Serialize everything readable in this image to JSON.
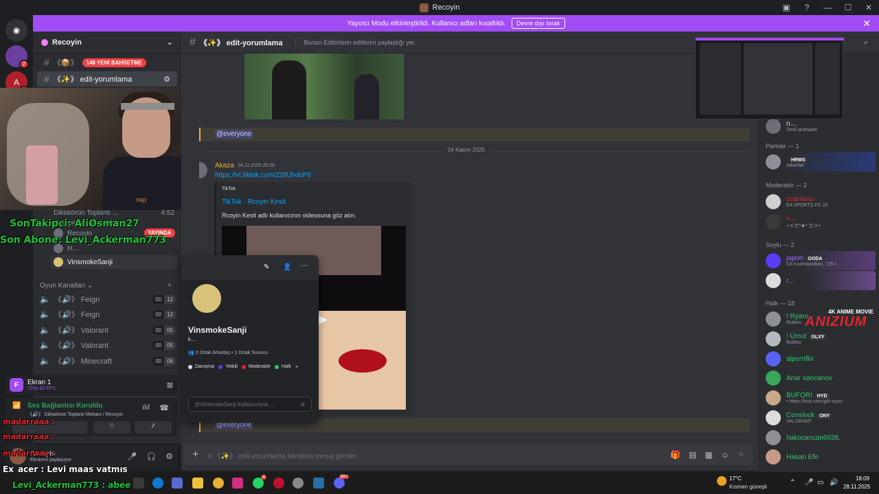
{
  "window": {
    "title": "Recoyin",
    "controls": [
      "?",
      "—",
      "☐",
      "✕"
    ]
  },
  "banner": {
    "message": "Yayıncı Modu etkinleştirildi. Kullanıcı adları kısaltıldı.",
    "button": "Devre dışı bırak",
    "accent": "#a14cf5"
  },
  "servers": {
    "badges": [
      "7",
      "2"
    ]
  },
  "sidebar": {
    "guild_name": "Recoyin",
    "channels": [
      {
        "name": "《📦》",
        "badge": "148 YENİ BAHSETME"
      },
      {
        "name": "《✨》 edit-yorumlama"
      }
    ],
    "voice_users": [
      {
        "name": "Diktatörün Toplantı ...",
        "meta": "4:52"
      },
      {
        "name": "Bir kanal duyurusu belirle"
      },
      {
        "name": "Recoyin",
        "badge": "YAYINDA"
      },
      {
        "name": "H..."
      },
      {
        "name": "VinsmokeSanji"
      }
    ],
    "games_category": "Oyun Kanalları",
    "voice_channels": [
      {
        "name": "《🔊》 Feign",
        "count_a": "00",
        "count_b": "12"
      },
      {
        "name": "《🔊》 Feign",
        "count_a": "00",
        "count_b": "12"
      },
      {
        "name": "《🔊》 Valorant",
        "count_a": "00",
        "count_b": "05"
      },
      {
        "name": "《🔊》 Valorant",
        "count_a": "00",
        "count_b": "05"
      },
      {
        "name": "《🔊》 Minecraft",
        "count_a": "00",
        "count_b": "06"
      }
    ]
  },
  "stream_overlay": {
    "last_follower": "SonTakipci: AliOsman27",
    "last_sub": "Son Abone: Levi_Ackerman773",
    "chat": [
      {
        "user": "madarraaa",
        "text": ":"
      },
      {
        "user": "madarraaa",
        "text": ":"
      },
      {
        "user": "madarraaa",
        "text": ":"
      }
    ],
    "chat_line": "Ex_acer : Levi maaş yatmış",
    "chat_line2": "Levi_Ackerman773 : abee",
    "webcam_shirt": "nap"
  },
  "screenshare": {
    "title": "Ekran 1",
    "quality": "720p 60 FPS",
    "letter": "F"
  },
  "voice_status": {
    "title": "Ses Bağlantısı Kuruldu",
    "channel": "《🔊》 Diktatörün Toplantı Mekanı / Recoyin"
  },
  "userbar": {
    "name": "Recoyin",
    "status": "Ekranını paylaşıyor"
  },
  "channel_header": {
    "name": "《✨》 edit-yorumlama",
    "topic": "Burası Editörlerin editlerini paylaştığı yer."
  },
  "messages": {
    "mention1": "@everyone",
    "date_separator": "24 Kasım 2025",
    "author": "Akaza",
    "timestamp": "24.11.2025 20:56",
    "link": "https://vt.tiktok.com/ZSfUhdoPt/",
    "embed_provider": "TikTok",
    "embed_title": "TikTok · Rcoyin Kesit",
    "embed_desc": "Rcoyin Kesit adlı kullanıcının videosuna göz atın.",
    "mention2": "@everyone"
  },
  "profile_popup": {
    "name": "VinsmokeSanji",
    "status": "k...",
    "mutual": "2 Ortak Arkadaş",
    "mutual_servers": "1 Ortak Sunucu",
    "roles": [
      {
        "name": "Danışma",
        "color": "#dbdee1"
      },
      {
        "name": "Yetkili",
        "color": "#5b3df5"
      },
      {
        "name": "Moderatör",
        "color": "#e3242b"
      },
      {
        "name": "Halk",
        "color": "#2dc770"
      }
    ],
    "message_placeholder": "@VinsmokeSanji kullanıcısına ..."
  },
  "composer": {
    "placeholder": "# 《✨》 edit-yorumlama kanalına mesaj gönder"
  },
  "members": {
    "top_sub": "Sesli aramada",
    "groups": [
      {
        "title": "Partner — 1",
        "items": [
          {
            "name": "",
            "tag": "HRMS",
            "sub": "Adamlar"
          }
        ]
      },
      {
        "title": "Moderatör — 2",
        "items": [
          {
            "name": "ccankmu",
            "sub": "EA SPORTS FC 25"
          },
          {
            "name": "v...",
            "sub": "+メ亗*★* 亗メ+"
          }
        ]
      },
      {
        "title": "Soylu — 2",
        "items": [
          {
            "name": "japon",
            "tag": "GODA",
            "sub": "D3 Kozmopolitan, 725 •"
          },
          {
            "name": "r..."
          }
        ]
      },
      {
        "title": "Halk — 18",
        "items": [
          {
            "name": "! Ryaro",
            "sub": "Roblox"
          },
          {
            "name": "! Umut",
            "tag": "GLXY",
            "sub": "Roblox"
          },
          {
            "name": "alpernflix"
          },
          {
            "name": "Anar xancanov"
          },
          {
            "name": "BUFORİ",
            "tag": "HYD",
            "sub": "• https://kick.com/gkt-zyxic"
          },
          {
            "name": "Conslock",
            "tag": "ONY",
            "sub": "VALORANT"
          },
          {
            "name": "hakocancan6638."
          },
          {
            "name": "Hasan Efe"
          }
        ]
      }
    ],
    "watermark_top": "4K ANIME MOVIE",
    "watermark": "ANIZIUM"
  },
  "taskbar": {
    "weather_temp": "17°C",
    "weather_desc": "Kısmen güneşli",
    "time": "18:09",
    "date": "28.11.2025",
    "badges": [
      "4",
      "99+"
    ]
  }
}
